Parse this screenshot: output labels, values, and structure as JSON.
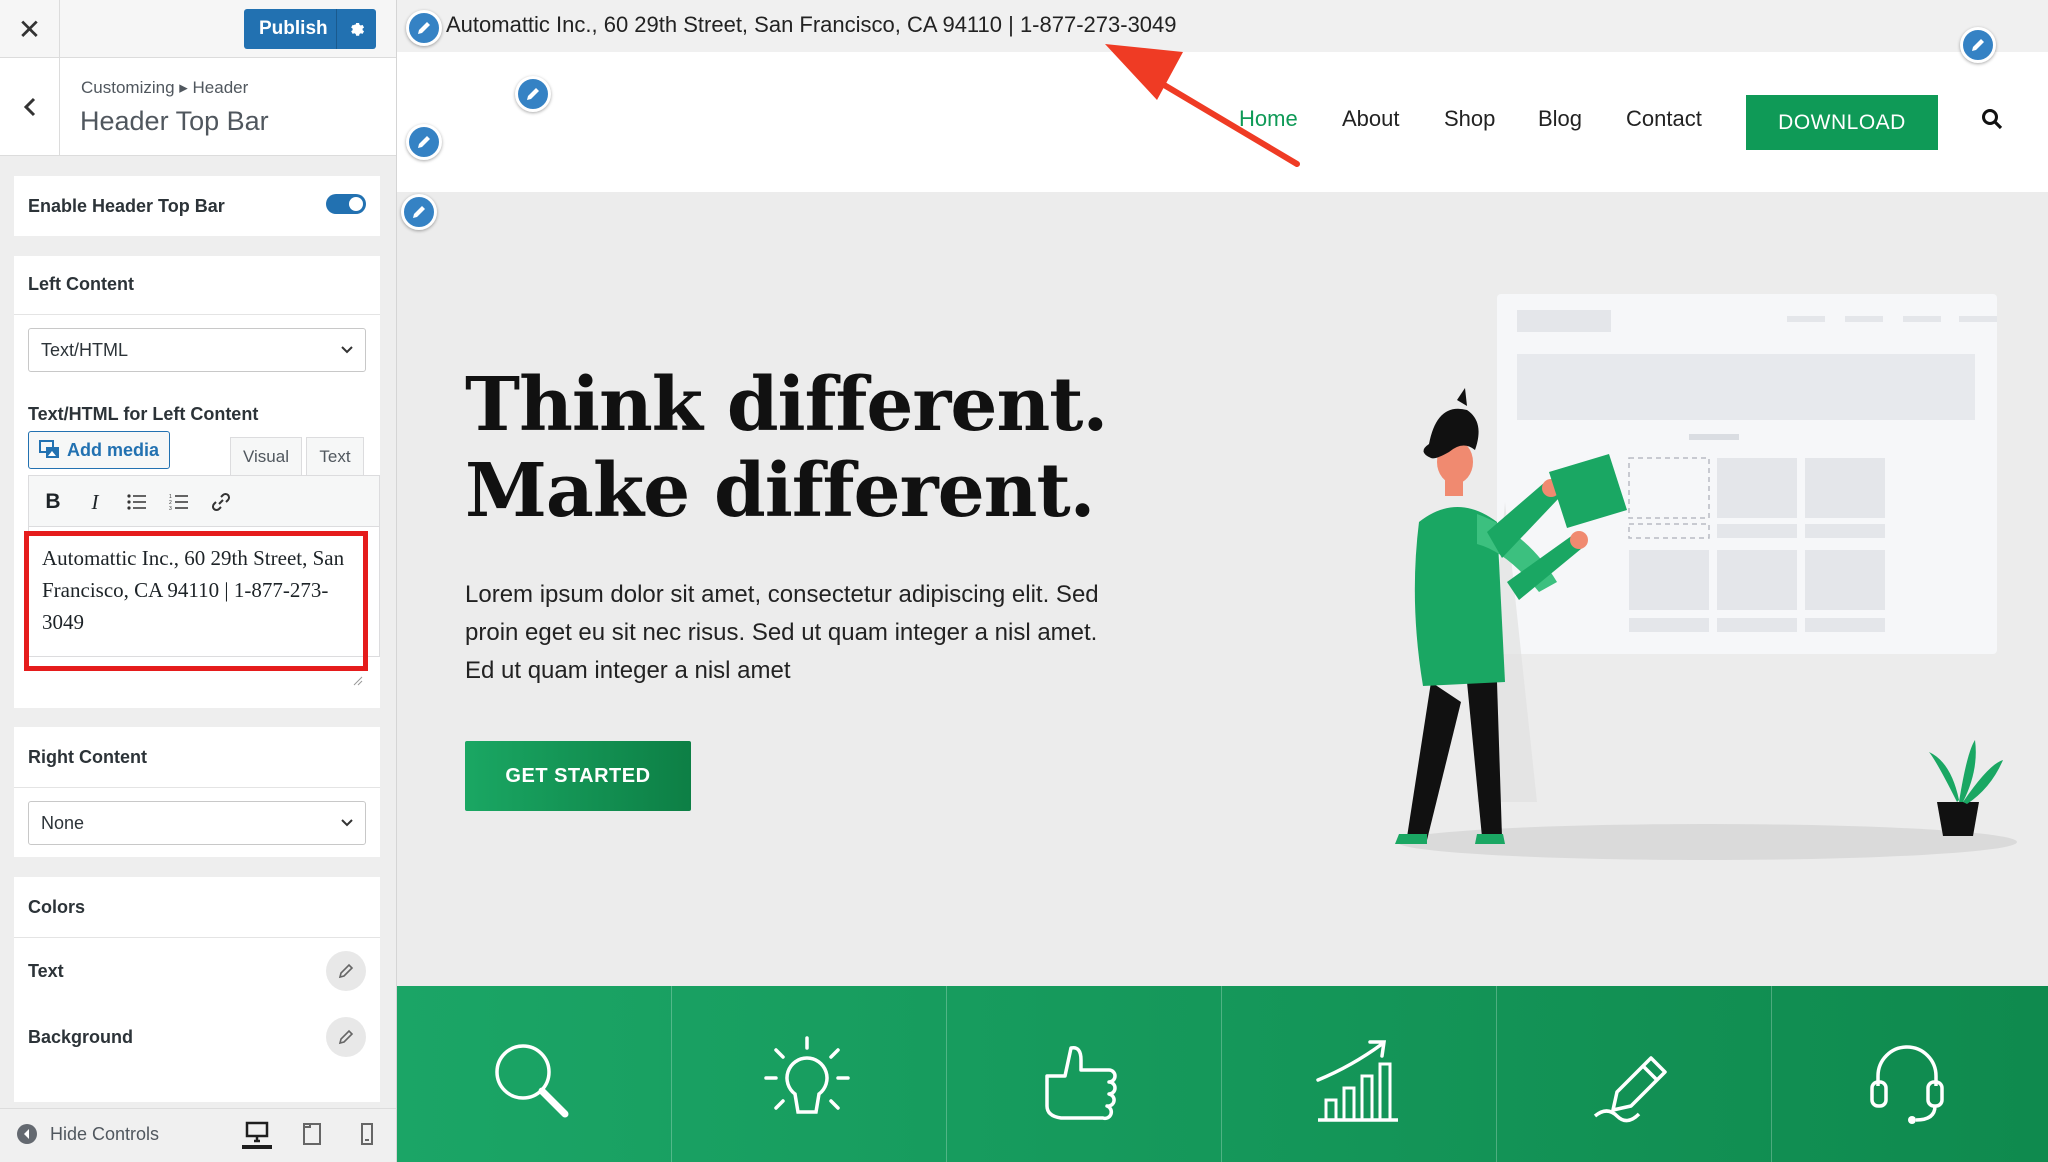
{
  "sidebar": {
    "close_label": "✕",
    "publish_label": "Publish",
    "breadcrumb": "Customizing ▸ Header",
    "panel_title": "Header Top Bar",
    "enable_label": "Enable Header Top Bar",
    "enable_on": true,
    "left_content": {
      "title": "Left Content",
      "select_value": "Text/HTML",
      "text_label": "Text/HTML for Left Content",
      "add_media_label": "Add media",
      "tab_visual": "Visual",
      "tab_text": "Text",
      "editor_text": "Automattic Inc., 60 29th Street, San Francisco, CA 94110 | 1-877-273-3049"
    },
    "right_content": {
      "title": "Right Content",
      "select_value": "None"
    },
    "colors": {
      "title": "Colors",
      "text_label": "Text",
      "background_label": "Background"
    },
    "footer": {
      "hide_controls_label": "Hide Controls"
    }
  },
  "preview": {
    "topbar_text": "Automattic Inc., 60 29th Street, San Francisco, CA 94110 | 1-877-273-3049",
    "nav": {
      "home": "Home",
      "about": "About",
      "shop": "Shop",
      "blog": "Blog",
      "contact": "Contact",
      "download": "DOWNLOAD"
    },
    "hero": {
      "title_line1": "Think different.",
      "title_line2": "Make different.",
      "body": "Lorem ipsum dolor sit amet, consectetur adipiscing elit. Sed proin eget eu sit nec risus. Sed ut quam integer a nisl amet.  Ed ut quam integer a nisl amet",
      "cta": "GET STARTED"
    },
    "features": [
      "search-icon",
      "lightbulb-icon",
      "thumbs-up-icon",
      "growth-chart-icon",
      "pen-icon",
      "headset-icon"
    ]
  },
  "colors": {
    "accent": "#0f9a57",
    "wp_blue": "#2271b1",
    "highlight_red": "#e51c1c",
    "edit_shortcut": "#3582c4"
  }
}
